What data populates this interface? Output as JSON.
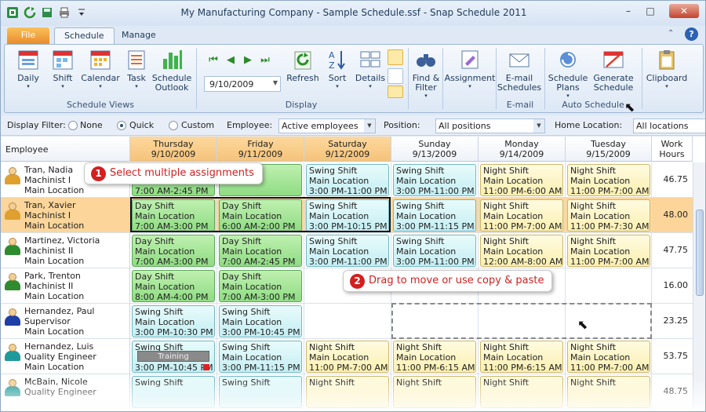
{
  "window": {
    "title": "My Manufacturing Company - Sample Schedule.ssf - Snap Schedule 2011",
    "minimize": "–",
    "maximize": "□",
    "close": "✕"
  },
  "ribbon": {
    "tabs": [
      "File",
      "Schedule",
      "Manage"
    ],
    "buttons": {
      "daily": "Daily",
      "shift": "Shift",
      "calendar": "Calendar",
      "task": "Task",
      "outlook": "Schedule Outlook",
      "refresh": "Refresh",
      "sort": "Sort",
      "details": "Details",
      "find": "Find & Filter",
      "assignment": "Assignment",
      "email": "E-mail Schedules",
      "plans": "Schedule Plans",
      "generate": "Generate Schedule",
      "clipboard": "Clipboard"
    },
    "date_value": "9/10/2009",
    "groups": {
      "views": "Schedule Views",
      "display": "Display",
      "email": "E-mail",
      "auto": "Auto Schedule"
    }
  },
  "filter": {
    "label": "Display Filter:",
    "none": "None",
    "quick": "Quick",
    "custom": "Custom",
    "employee_label": "Employee:",
    "employee_value": "Active employees",
    "position_label": "Position:",
    "position_value": "All positions",
    "home_label": "Home Location:",
    "home_value": "All locations"
  },
  "grid": {
    "employee_header": "Employee",
    "hours_header": "Work Hours",
    "days": [
      {
        "dow": "Thursday",
        "date": "9/10/2009"
      },
      {
        "dow": "Friday",
        "date": "9/11/2009"
      },
      {
        "dow": "Saturday",
        "date": "9/12/2009"
      },
      {
        "dow": "Sunday",
        "date": "9/13/2009"
      },
      {
        "dow": "Monday",
        "date": "9/14/2009"
      },
      {
        "dow": "Tuesday",
        "date": "9/15/2009"
      }
    ],
    "rows": [
      {
        "name": "Tran, Nadia",
        "role": "Machinist I",
        "loc": "Main Location",
        "hours": "46.75",
        "color": "#e0a030",
        "cells": [
          {
            "name": "",
            "loc": "",
            "time": "7:00 AM-2:45 PM",
            "type": "day"
          },
          {
            "name": "",
            "loc": "",
            "time": "",
            "type": "day"
          },
          {
            "name": "Swing Shift",
            "loc": "Main Location",
            "time": "3:00 PM-11:00 PM",
            "type": "swing"
          },
          {
            "name": "Swing Shift",
            "loc": "Main Location",
            "time": "3:00 PM-11:00 PM",
            "type": "swing"
          },
          {
            "name": "Night Shift",
            "loc": "Main Location",
            "time": "11:00 PM-6:00 AM",
            "type": "night"
          },
          {
            "name": "Night Shift",
            "loc": "Main Location",
            "time": "11:00 PM-7:00 AM",
            "type": "night"
          }
        ]
      },
      {
        "name": "Tran, Xavier",
        "role": "Machinist I",
        "loc": "Main Location",
        "hours": "48.00",
        "color": "#e0a030",
        "cells": [
          {
            "name": "Day Shift",
            "loc": "Main Location",
            "time": "7:00 AM-3:00 PM",
            "type": "day"
          },
          {
            "name": "Day Shift",
            "loc": "Main Location",
            "time": "6:00 AM-2:00 PM",
            "type": "day"
          },
          {
            "name": "Swing Shift",
            "loc": "Main Location",
            "time": "3:00 PM-10:15 PM",
            "type": "swing"
          },
          {
            "name": "Swing Shift",
            "loc": "Main Location",
            "time": "3:00 PM-11:15 PM",
            "type": "swing"
          },
          {
            "name": "Night Shift",
            "loc": "Main Location",
            "time": "11:00 PM-7:00 AM",
            "type": "night"
          },
          {
            "name": "Night Shift",
            "loc": "Main Location",
            "time": "11:00 PM-7:30 AM",
            "type": "night"
          }
        ]
      },
      {
        "name": "Martinez, Victoria",
        "role": "Machinist II",
        "loc": "Main Location",
        "hours": "47.75",
        "color": "#2e8b2e",
        "cells": [
          {
            "name": "Day Shift",
            "loc": "Main Location",
            "time": "7:00 AM-3:00 PM",
            "type": "day"
          },
          {
            "name": "Day Shift",
            "loc": "Main Location",
            "time": "7:00 AM-2:45 PM",
            "type": "day"
          },
          {
            "name": "Swing Shift",
            "loc": "Main Location",
            "time": "3:00 PM-11:00 PM",
            "type": "swing"
          },
          {
            "name": "Swing Shift",
            "loc": "Main Location",
            "time": "3:00 PM-11:00 PM",
            "type": "swing"
          },
          {
            "name": "Night Shift",
            "loc": "Main Location",
            "time": "12:00 AM-8:00 AM",
            "type": "night"
          },
          {
            "name": "Night Shift",
            "loc": "Main Location",
            "time": "11:00 PM-7:00 AM",
            "type": "night"
          }
        ]
      },
      {
        "name": "Park, Trenton",
        "role": "Machinist II",
        "loc": "Main Location",
        "hours": "16.00",
        "color": "#2e8b2e",
        "cells": [
          {
            "name": "Day Shift",
            "loc": "Main Location",
            "time": "8:00 AM-4:00 PM",
            "type": "day"
          },
          {
            "name": "Day Shift",
            "loc": "Main Location",
            "time": "7:00 AM-3:00 PM",
            "type": "day"
          },
          null,
          null,
          null,
          null
        ]
      },
      {
        "name": "Hernandez, Paul",
        "role": "Supervisor",
        "loc": "Main Location",
        "hours": "23.25",
        "color": "#1f3fa8",
        "cells": [
          {
            "name": "Swing Shift",
            "loc": "Main Location",
            "time": "3:00 PM-10:30 PM",
            "type": "swing"
          },
          {
            "name": "Swing Shift",
            "loc": "Main Location",
            "time": "3:00 PM-10:45 PM",
            "type": "swing"
          },
          null,
          null,
          null,
          null
        ]
      },
      {
        "name": "Hernandez, Luis",
        "role": "Quality Engineer",
        "loc": "Main Location",
        "hours": "53.75",
        "color": "#1f9a9a",
        "cells": [
          {
            "name": "Swing Shift",
            "loc": "",
            "time": "3:00 PM-10:45 PM",
            "type": "swing",
            "badge": "Training"
          },
          {
            "name": "Swing Shift",
            "loc": "Main Location",
            "time": "3:00 PM-11:15 PM",
            "type": "swing"
          },
          {
            "name": "Night Shift",
            "loc": "Main Location",
            "time": "11:00 PM-7:00 AM",
            "type": "night"
          },
          {
            "name": "Night Shift",
            "loc": "Main Location",
            "time": "11:00 PM-6:15 AM",
            "type": "night"
          },
          {
            "name": "Night Shift",
            "loc": "Main Location",
            "time": "11:00 PM-6:15 AM",
            "type": "night"
          },
          {
            "name": "Night Shift",
            "loc": "Main Location",
            "time": "11:00 PM-7:00 AM",
            "type": "night"
          }
        ]
      },
      {
        "name": "McBain, Nicole",
        "role": "Quality Engineer",
        "loc": "",
        "hours": "48.75",
        "color": "#1f9a9a",
        "cells": [
          {
            "name": "Swing Shift",
            "loc": "",
            "time": "",
            "type": "swing"
          },
          {
            "name": "Swing Shift",
            "loc": "",
            "time": "",
            "type": "swing"
          },
          {
            "name": "Night Shift",
            "loc": "",
            "time": "",
            "type": "night"
          },
          {
            "name": "Night Shift",
            "loc": "",
            "time": "",
            "type": "night"
          },
          {
            "name": "Night Shift",
            "loc": "",
            "time": "",
            "type": "night"
          },
          {
            "name": "Night Shift",
            "loc": "",
            "time": "",
            "type": "night"
          }
        ]
      }
    ]
  },
  "callouts": {
    "one_num": "1",
    "one_text": "Select multiple assignments",
    "two_num": "2",
    "two_text": "Drag to move or use copy & paste"
  }
}
